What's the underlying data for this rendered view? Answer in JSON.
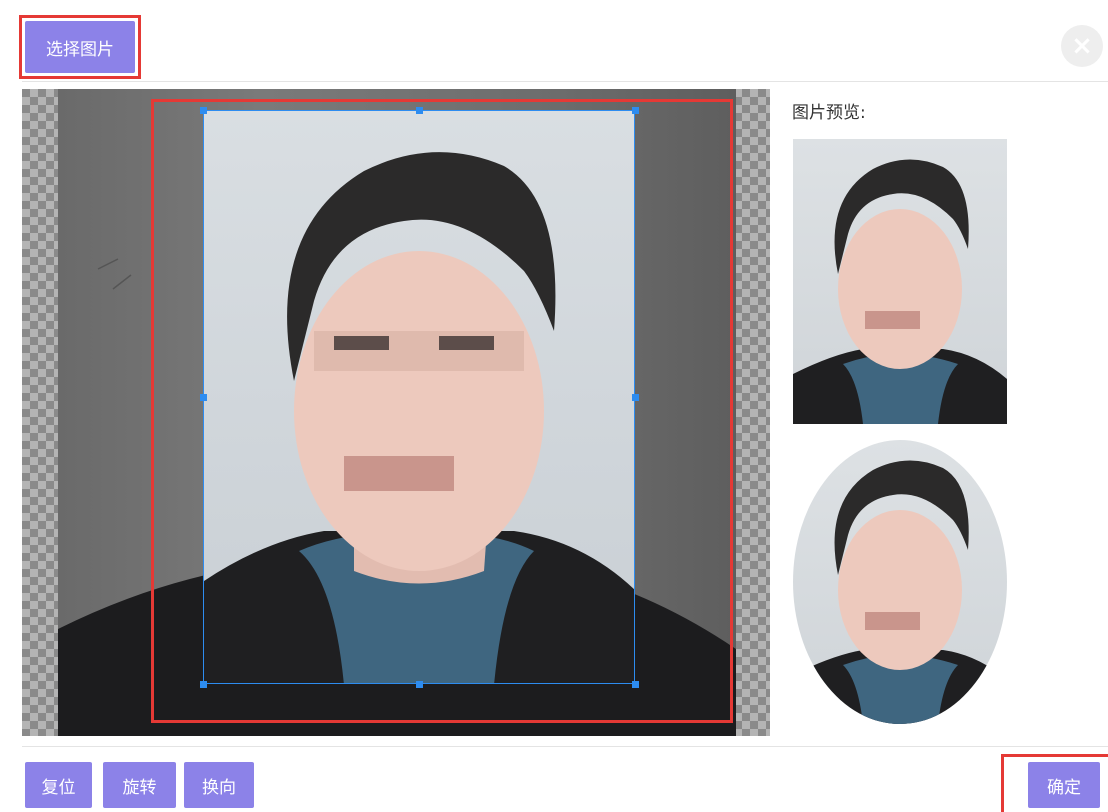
{
  "toolbar": {
    "select_image_label": "选择图片"
  },
  "close": {
    "icon": "close-icon",
    "glyph": "×"
  },
  "preview": {
    "title": "图片预览:"
  },
  "actions": {
    "reset_label": "复位",
    "rotate_label": "旋转",
    "flip_label": "换向",
    "confirm_label": "确定"
  },
  "colors": {
    "button": "#8c82e8",
    "crop_border": "#2d8cf0",
    "highlight": "#e53935"
  }
}
